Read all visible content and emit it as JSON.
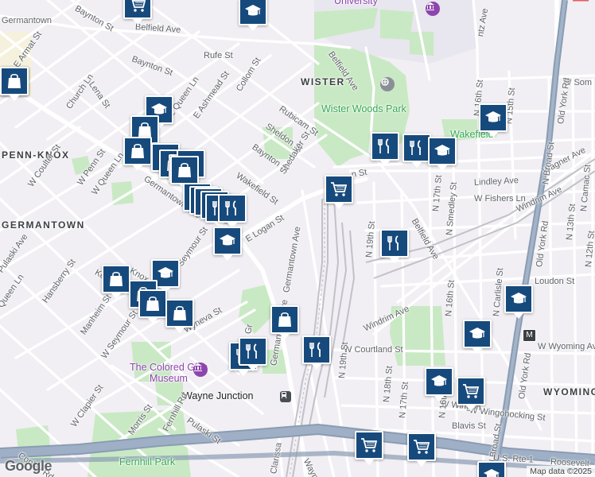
{
  "neighborhoods": [
    "WISTER",
    "PENN-KNOX",
    "GERMANTOWN",
    "WYOMING",
    "Germantown"
  ],
  "parks": [
    "Wister Woods Park",
    "Fernhill Park",
    "Wakefield"
  ],
  "pois": [
    "The Colored Girls Museum",
    "University"
  ],
  "transit": [
    "Wayne Junction"
  ],
  "streets": {
    "belfield_ave_top": "Belfield Ave",
    "belfield_ave_mid": "Belfield Ave",
    "belfield_ave_right": "Belfield Ave",
    "bayn_top": "Baynton St",
    "bayn_mid": "Baynton St",
    "bayn_low": "Baynton St",
    "rufe": "Rufe St",
    "collom": "Collom St",
    "rubicam": "Rubicam St",
    "sheldon": "Sheldon St",
    "shedaker": "Shedaker St",
    "wakefield": "Wakefield St",
    "e_logan": "E Logan St",
    "logan_right": "n St",
    "lindley": "Lindley Ave",
    "w_fishers": "W Fishers Ln",
    "windrim_right": "Windrim Ave",
    "windrim_low": "Windrim Ave",
    "wagner": "Wagner Ave",
    "w_somerville": "W Som",
    "w_courtland": "W Courtland St",
    "w_wyoming": "W Wyoming Ave",
    "w_wingohocking": "W Wingohocking St",
    "w_wingohocking_low": "W Wingohocking St",
    "w_wingo_mid": "W Wingoh",
    "blavis": "Blavis St",
    "loudon": "Loudon St",
    "w_loudon_partial": "Loudon St",
    "e_armat": "E Armat St",
    "church": "Church Ln",
    "lena": "Lena St",
    "e_queen": "E Queen Ln",
    "e_ashmead": "E Ashmead St",
    "germantown_ave_nw": "Germantown Ave",
    "germantown_ave_s": "Germantown Ave",
    "germantown_ave_low": "Germantown Ave",
    "w_penn": "W Penn St",
    "w_queen": "W Queen Ln",
    "w_coulter": "W Coulter St",
    "queen_ln": "Queen Ln",
    "pulaski_top": "Pulaski Ave",
    "pulaski_low": "Pulaski St",
    "hansberry": "Hansberry St",
    "manheim": "Manheim St",
    "w_seymour": "W Seymour St",
    "seymour": "Seymour St",
    "keyser": "Keyser",
    "knox": "Knox",
    "wyneva": "Wyneva St",
    "w_clapier": "W Clapier St",
    "morris": "Morris St",
    "fernhill_rd": "Fernhill Rd",
    "copley": "Copley Rd",
    "clarissa": "Clarissa",
    "wayne_ave": "Wayne Ave",
    "n_19th_top": "N 19th St",
    "n_19th_low": "N 19th St",
    "n_18th": "N 18th St",
    "n_17th_top": "N 17th St",
    "n_17th_low": "N 17th St",
    "n_smedley": "N Smedley St",
    "n_16th_top": "N 16th St",
    "n_16th_mid": "N 16th St",
    "n_16th_low": "N 16th St",
    "n_15th": "N 15th St",
    "n_carlisle": "N Carlisle St",
    "n_broad_top": "N Broad St",
    "n_broad_low": "N Broad St",
    "old_york_top": "Old York Rd",
    "old_york_mid": "Old York Rd",
    "old_york_low": "Old York Rd",
    "n_13th": "N 13th St",
    "n_12th": "N 12th St",
    "n_camac": "N Camac St",
    "n_lee": "ntz Ave",
    "us_rte": "U.S. Rte 1",
    "roosevelt": "Roosevelt",
    "grange": "Gr",
    "e_armat_2": "E Armat"
  },
  "markers": [
    {
      "kind": "school",
      "label": "school"
    },
    {
      "kind": "shopping",
      "label": "shopping"
    },
    {
      "kind": "restaurant",
      "label": "restaurant"
    }
  ],
  "google_logo": "Google",
  "attribution": "Map data ©2025",
  "route_shield": "M",
  "colors": {
    "pin_bg": "#174a7c",
    "park": "#c9e9c4",
    "road": "#ffffff",
    "highway": "#8a9cb3",
    "rail": "#b9b9bf",
    "poi": "#8e44ad"
  }
}
